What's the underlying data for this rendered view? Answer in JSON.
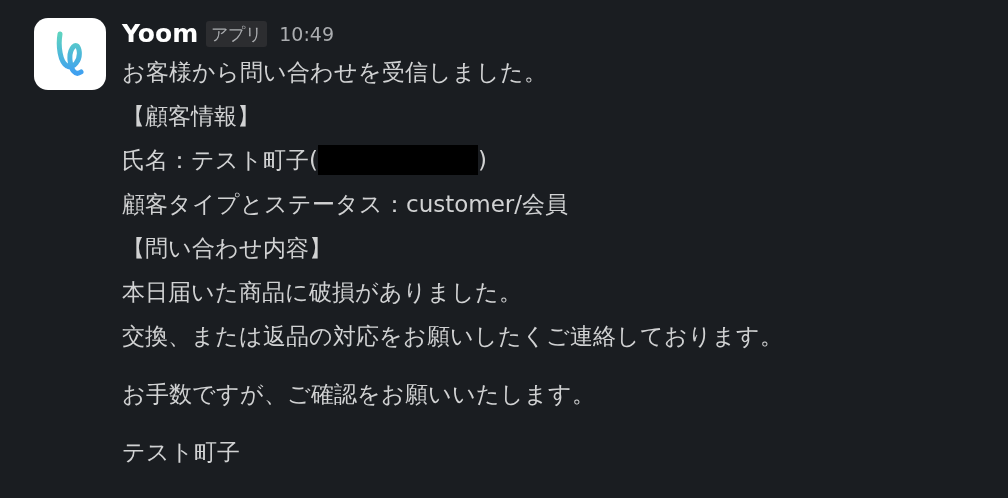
{
  "message": {
    "sender": "Yoom",
    "badge": "アプリ",
    "time": "10:49",
    "paragraphs": [
      [
        {
          "kind": "text",
          "text": "お客様から問い合わせを受信しました。"
        },
        {
          "kind": "text",
          "text": "【顧客情報】"
        },
        {
          "kind": "redacted",
          "prefix": "氏名：テスト町子(",
          "suffix": ")"
        },
        {
          "kind": "text",
          "text": "顧客タイプとステータス：customer/会員"
        },
        {
          "kind": "text",
          "text": "【問い合わせ内容】"
        },
        {
          "kind": "text",
          "text": "本日届いた商品に破損がありました。"
        },
        {
          "kind": "text",
          "text": "交換、または返品の対応をお願いしたくご連絡しております。"
        }
      ],
      [
        {
          "kind": "text",
          "text": "お手数ですが、ご確認をお願いいたします。"
        }
      ],
      [
        {
          "kind": "text",
          "text": "テスト町子"
        }
      ]
    ]
  }
}
